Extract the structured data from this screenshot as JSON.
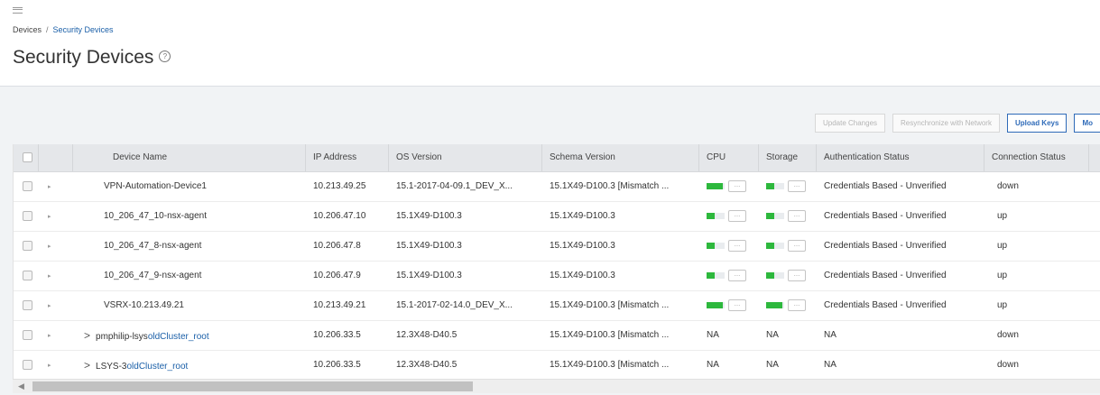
{
  "breadcrumb": {
    "parent": "Devices",
    "separator": "/",
    "current": "Security Devices"
  },
  "page": {
    "title": "Security Devices",
    "help_glyph": "?"
  },
  "toolbar": {
    "update_changes": "Update Changes",
    "resynchronize": "Resynchronize with Network",
    "upload_keys": "Upload Keys",
    "more": "Mo"
  },
  "table": {
    "headers": [
      "Device Name",
      "IP Address",
      "OS Version",
      "Schema Version",
      "CPU",
      "Storage",
      "Authentication Status",
      "Connection Status"
    ],
    "rows": [
      {
        "name": "VPN-Automation-Device1",
        "ip": "10.213.49.25",
        "os": "15.1-2017-04-09.1_DEV_X...",
        "schema": "15.1X49-D100.3 [Mismatch ...",
        "cpu_pct": 90,
        "storage_pct": 45,
        "auth": "Credentials Based - Unverified",
        "conn": "down"
      },
      {
        "name": "10_206_47_10-nsx-agent",
        "ip": "10.206.47.10",
        "os": "15.1X49-D100.3",
        "schema": "15.1X49-D100.3",
        "cpu_pct": 45,
        "storage_pct": 45,
        "auth": "Credentials Based - Unverified",
        "conn": "up"
      },
      {
        "name": "10_206_47_8-nsx-agent",
        "ip": "10.206.47.8",
        "os": "15.1X49-D100.3",
        "schema": "15.1X49-D100.3",
        "cpu_pct": 45,
        "storage_pct": 45,
        "auth": "Credentials Based - Unverified",
        "conn": "up"
      },
      {
        "name": "10_206_47_9-nsx-agent",
        "ip": "10.206.47.9",
        "os": "15.1X49-D100.3",
        "schema": "15.1X49-D100.3",
        "cpu_pct": 45,
        "storage_pct": 45,
        "auth": "Credentials Based - Unverified",
        "conn": "up"
      },
      {
        "name": "VSRX-10.213.49.21",
        "ip": "10.213.49.21",
        "os": "15.1-2017-02-14.0_DEV_X...",
        "schema": "15.1X49-D100.3 [Mismatch ...",
        "cpu_pct": 90,
        "storage_pct": 90,
        "auth": "Credentials Based - Unverified",
        "conn": "up"
      }
    ],
    "cluster_rows": [
      {
        "name_prefix": "pmphilip-lsys",
        "name_link": "oldCluster_root",
        "ip": "10.206.33.5",
        "os": "12.3X48-D40.5",
        "schema": "15.1X49-D100.3 [Mismatch ...",
        "cpu": "NA",
        "storage": "NA",
        "auth": "NA",
        "conn": "down"
      },
      {
        "name_prefix": "LSYS-3",
        "name_link": "oldCluster_root",
        "ip": "10.206.33.5",
        "os": "12.3X48-D40.5",
        "schema": "15.1X49-D100.3 [Mismatch ...",
        "cpu": "NA",
        "storage": "NA",
        "auth": "NA",
        "conn": "down"
      }
    ]
  },
  "icons": {
    "menu": "hamburger-icon",
    "expand": "caret-right-icon",
    "chevron": "chevron-right-icon",
    "details": "ellipsis-icon",
    "scroll_left": "scroll-left-icon"
  },
  "colors": {
    "usage_bar": "#2db83d",
    "link": "#1a5fa8",
    "primary_button": "#2e6ab8",
    "header_bg": "#e5e7ea"
  }
}
